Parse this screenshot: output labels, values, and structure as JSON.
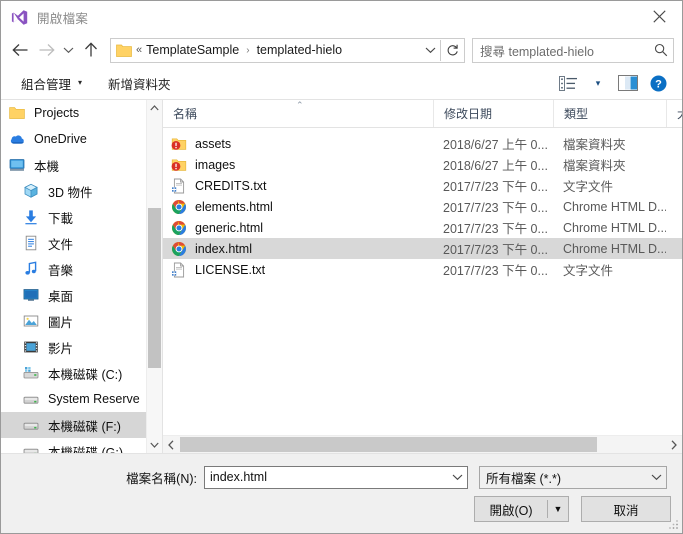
{
  "window": {
    "title": "開啟檔案",
    "app_icon": "visual-studio-logo",
    "close_icon": "close-icon"
  },
  "nav": {
    "back_icon": "arrow-left-icon",
    "forward_icon": "arrow-right-icon",
    "recent_icon": "chevron-down-icon",
    "up_icon": "arrow-up-icon",
    "address": {
      "folder_icon": "folder-icon",
      "overflow": "«",
      "crumbs": [
        "TemplateSample",
        "templated-hielo"
      ],
      "separator": "›",
      "dropdown_icon": "chevron-down-icon",
      "refresh_icon": "refresh-icon"
    },
    "search": {
      "placeholder": "搜尋 templated-hielo",
      "icon": "search-icon"
    }
  },
  "toolbar": {
    "organize_label": "組合管理",
    "organize_caret": "▾",
    "new_folder_label": "新增資料夾",
    "view_options_icon": "view-options-icon",
    "view_caret": "▾",
    "preview_pane_icon": "preview-pane-icon",
    "help_icon": "help-icon"
  },
  "sidebar": {
    "items": [
      {
        "label": "Projects",
        "icon": "folder-icon",
        "indent": 0,
        "selected": false
      },
      {
        "label": "OneDrive",
        "icon": "onedrive-cloud-icon",
        "indent": 0,
        "selected": false
      },
      {
        "label": "本機",
        "icon": "this-pc-icon",
        "indent": 0,
        "selected": false
      },
      {
        "label": "3D 物件",
        "icon": "3d-objects-icon",
        "indent": 1,
        "selected": false
      },
      {
        "label": "下載",
        "icon": "downloads-icon",
        "indent": 1,
        "selected": false
      },
      {
        "label": "文件",
        "icon": "documents-icon",
        "indent": 1,
        "selected": false
      },
      {
        "label": "音樂",
        "icon": "music-icon",
        "indent": 1,
        "selected": false
      },
      {
        "label": "桌面",
        "icon": "desktop-icon",
        "indent": 1,
        "selected": false
      },
      {
        "label": "圖片",
        "icon": "pictures-icon",
        "indent": 1,
        "selected": false
      },
      {
        "label": "影片",
        "icon": "videos-icon",
        "indent": 1,
        "selected": false
      },
      {
        "label": "本機磁碟 (C:)",
        "icon": "system-drive-icon",
        "indent": 1,
        "selected": false
      },
      {
        "label": "System Reserve",
        "icon": "drive-icon",
        "indent": 1,
        "selected": false
      },
      {
        "label": "本機磁碟 (F:)",
        "icon": "drive-icon",
        "indent": 1,
        "selected": true
      },
      {
        "label": "本機磁碟 (G:)",
        "icon": "drive-icon",
        "indent": 1,
        "selected": false
      }
    ],
    "scroll_up_icon": "chevron-up-icon",
    "scroll_down_icon": "chevron-down-icon"
  },
  "filelist": {
    "columns": [
      {
        "label": "名稱",
        "sorted": "asc",
        "sort_glyph": "⌃"
      },
      {
        "label": "修改日期",
        "sorted": "",
        "sort_glyph": ""
      },
      {
        "label": "類型",
        "sorted": "",
        "sort_glyph": ""
      },
      {
        "label": "大",
        "sorted": "",
        "sort_glyph": ""
      }
    ],
    "rows": [
      {
        "name": "assets",
        "icon": "folder-blocked-icon",
        "date": "2018/6/27 上午 0...",
        "type": "檔案資料夾",
        "size": "",
        "selected": false
      },
      {
        "name": "images",
        "icon": "folder-blocked-icon",
        "date": "2018/6/27 上午 0...",
        "type": "檔案資料夾",
        "size": "",
        "selected": false
      },
      {
        "name": "CREDITS.txt",
        "icon": "text-file-icon",
        "date": "2017/7/23 下午 0...",
        "type": "文字文件",
        "size": "",
        "selected": false
      },
      {
        "name": "elements.html",
        "icon": "chrome-icon",
        "date": "2017/7/23 下午 0...",
        "type": "Chrome HTML D...",
        "size": "",
        "selected": false
      },
      {
        "name": "generic.html",
        "icon": "chrome-icon",
        "date": "2017/7/23 下午 0...",
        "type": "Chrome HTML D...",
        "size": "",
        "selected": false
      },
      {
        "name": "index.html",
        "icon": "chrome-icon",
        "date": "2017/7/23 下午 0...",
        "type": "Chrome HTML D...",
        "size": "",
        "selected": true
      },
      {
        "name": "LICENSE.txt",
        "icon": "text-file-icon",
        "date": "2017/7/23 下午 0...",
        "type": "文字文件",
        "size": "",
        "selected": false
      }
    ],
    "hscroll_left_icon": "chevron-left-icon",
    "hscroll_right_icon": "chevron-right-icon"
  },
  "footer": {
    "filename_label": "檔案名稱(N):",
    "filename_value": "index.html",
    "filename_dropdown_icon": "chevron-down-icon",
    "filter_value": "所有檔案 (*.*)",
    "filter_dropdown_icon": "chevron-down-icon",
    "open_label": "開啟(O)",
    "open_split_caret": "▼",
    "cancel_label": "取消",
    "resize_grip_icon": "resize-grip-icon"
  },
  "colors": {
    "selection": "#d8d8d8",
    "sidebar_selection": "#d6d6d6",
    "chrome_blue": "#2a7de1",
    "chrome_red": "#dd4b38",
    "chrome_yellow": "#f3bb00",
    "chrome_green": "#1aa260",
    "folder_yellow": "#ffd264",
    "help_blue": "#0b6fc4",
    "vs_purple": "#8a53c1"
  }
}
